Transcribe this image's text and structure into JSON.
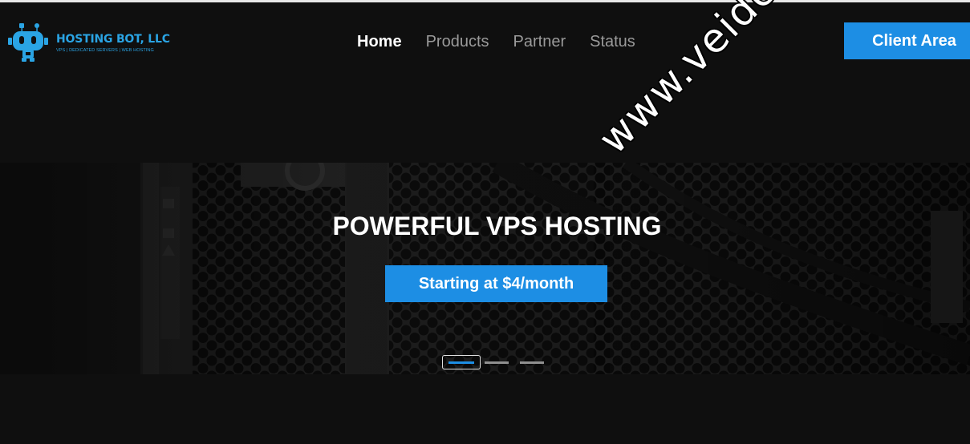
{
  "brand": {
    "name": "HOSTING BOT, LLC",
    "tagline": "VPS | DEDICATED SERVERS | WEB HOSTING",
    "accent": "#1d8ee4"
  },
  "nav": {
    "items": [
      {
        "label": "Home",
        "active": true
      },
      {
        "label": "Products",
        "active": false
      },
      {
        "label": "Partner",
        "active": false
      },
      {
        "label": "Status",
        "active": false
      }
    ],
    "client_area": "Client Area"
  },
  "hero": {
    "title": "POWERFUL VPS HOSTING",
    "cta": "Starting at $4/month",
    "slides": 3,
    "active_slide": 1
  },
  "watermark": "www.veidc.com"
}
